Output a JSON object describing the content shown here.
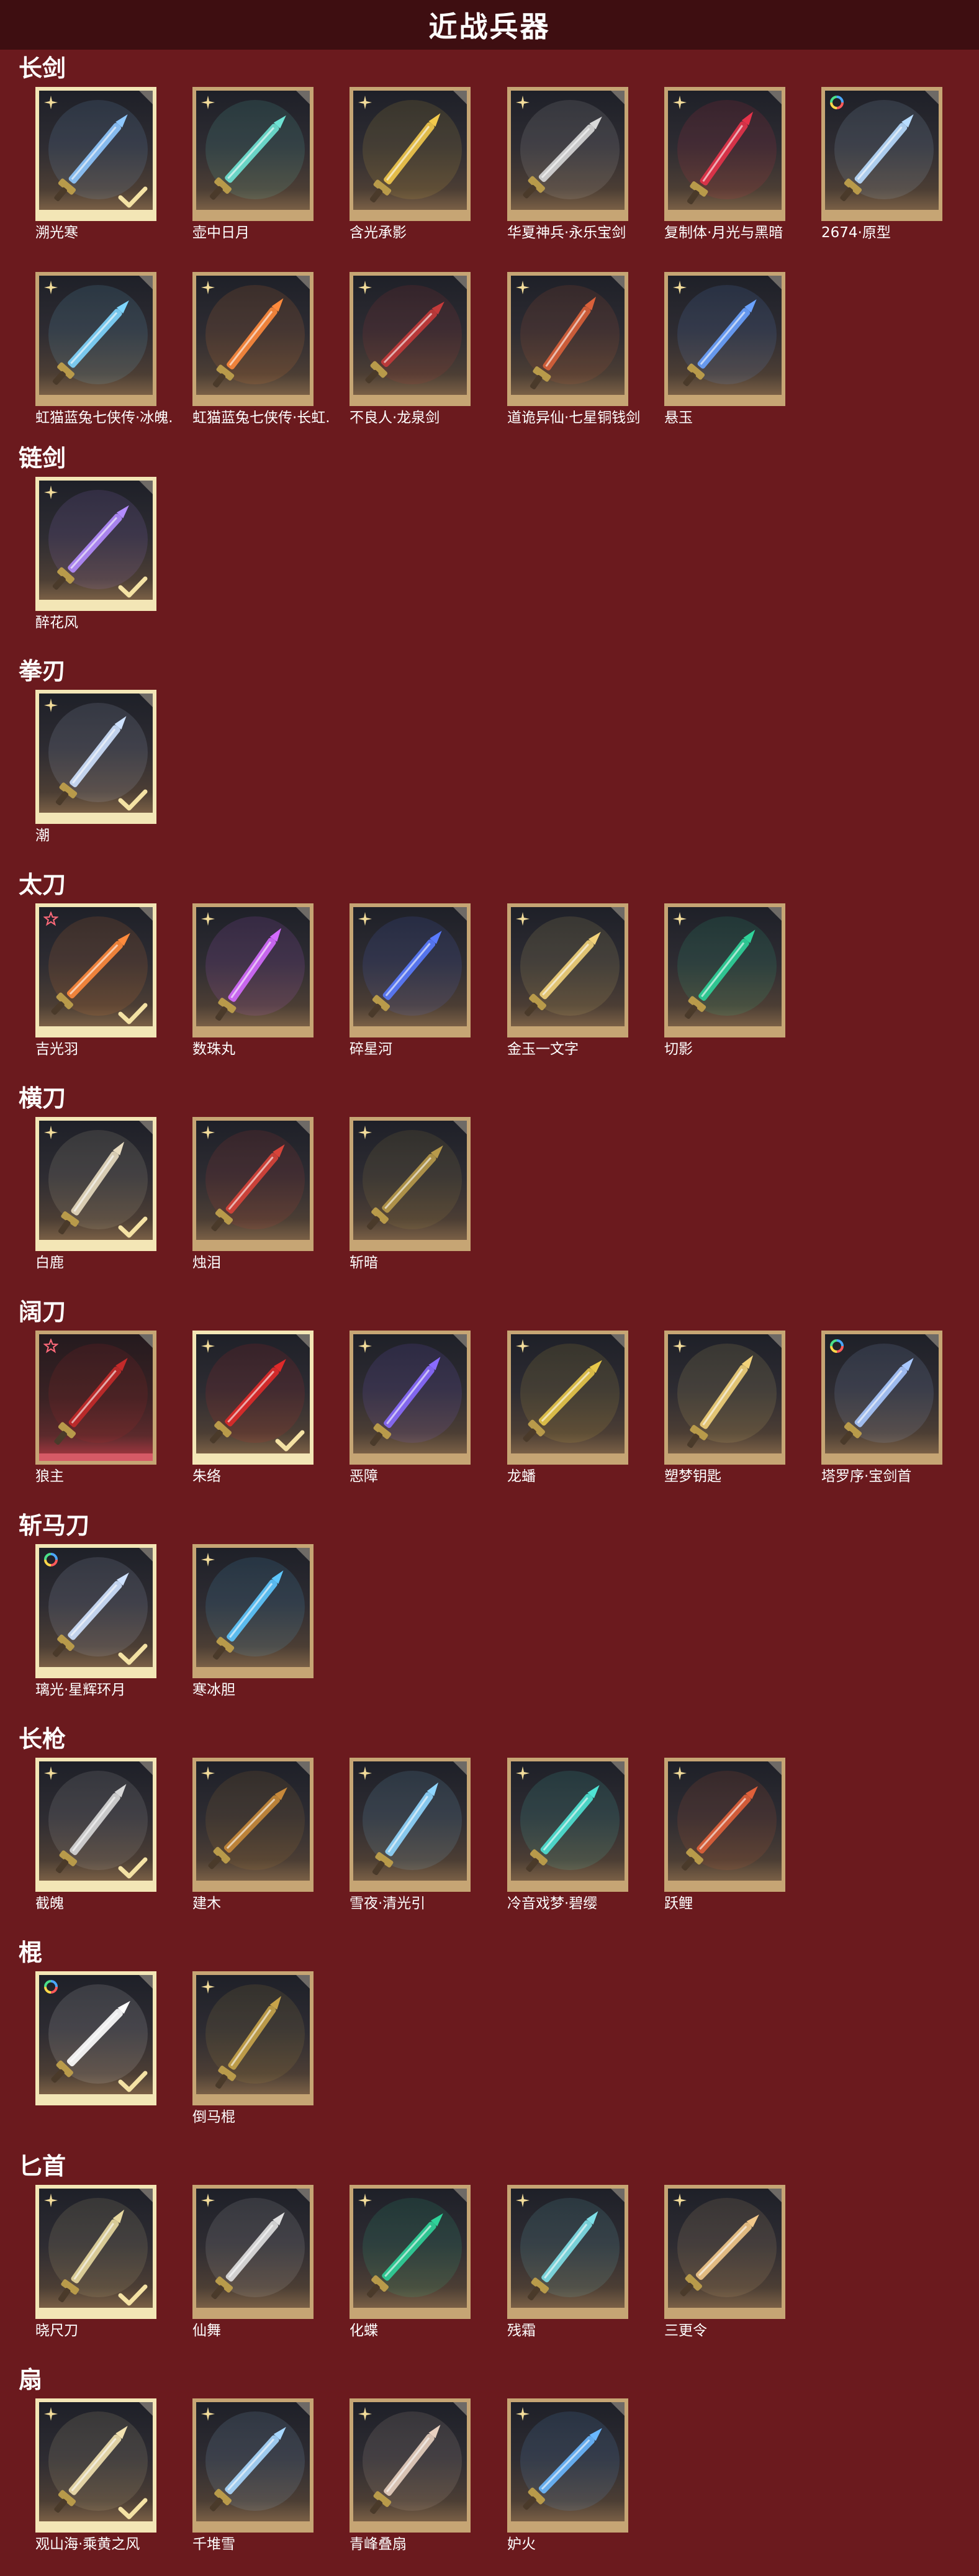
{
  "page": {
    "title": "近战兵器"
  },
  "colors": {
    "background": "#6b1a1e",
    "titlebar": "#3e0e11",
    "frame": "#c6a574",
    "frame_selected": "#f3e6b6"
  },
  "categories": [
    {
      "title": "长剑",
      "items": [
        {
          "name": "溯光寒",
          "rarity": "star-gold",
          "selected": true,
          "glow": "#8fc8ff",
          "hue": "ice"
        },
        {
          "name": "壶中日月",
          "rarity": "star-gold",
          "selected": false,
          "glow": "#6fe3d4",
          "hue": "teal"
        },
        {
          "name": "含光承影",
          "rarity": "star-gold",
          "selected": false,
          "glow": "#f2c94c",
          "hue": "gold"
        },
        {
          "name": "华夏神兵·永乐宝剑",
          "rarity": "star-gold",
          "selected": false,
          "glow": "#d8d8d8",
          "hue": "silver"
        },
        {
          "name": "复制体·月光与黑暗",
          "rarity": "star-gold",
          "selected": false,
          "glow": "#e5334a",
          "hue": "red"
        },
        {
          "name": "2674·原型",
          "rarity": "rainbow",
          "selected": false,
          "glow": "#b8dcff",
          "hue": "white"
        },
        {
          "name": "虹猫蓝兔七侠传·冰魄..",
          "rarity": "star-gold",
          "selected": false,
          "glow": "#7fd6ff",
          "hue": "ice"
        },
        {
          "name": "虹猫蓝兔七侠传·长虹..",
          "rarity": "star-gold",
          "selected": false,
          "glow": "#ff8a3c",
          "hue": "orange"
        },
        {
          "name": "不良人·龙泉剑",
          "rarity": "star-gold",
          "selected": false,
          "glow": "#c43a3a",
          "hue": "dark"
        },
        {
          "name": "道诡异仙·七星铜钱剑",
          "rarity": "star-gold",
          "selected": false,
          "glow": "#d9603a",
          "hue": "red"
        },
        {
          "name": "悬玉",
          "rarity": "star-gold",
          "selected": false,
          "glow": "#6aa2ff",
          "hue": "blue"
        }
      ]
    },
    {
      "title": "链剑",
      "items": [
        {
          "name": "醉花风",
          "rarity": "star-gold",
          "selected": true,
          "glow": "#b48cff",
          "hue": "purple"
        }
      ]
    },
    {
      "title": "拳刃",
      "items": [
        {
          "name": "潮",
          "rarity": "star-gold",
          "selected": true,
          "glow": "#cfe2ff",
          "hue": "white"
        }
      ]
    },
    {
      "title": "太刀",
      "items": [
        {
          "name": "吉光羽",
          "rarity": "star-red",
          "selected": true,
          "glow": "#ff8a3c",
          "hue": "orange"
        },
        {
          "name": "数珠丸",
          "rarity": "star-gold",
          "selected": false,
          "glow": "#d46bff",
          "hue": "purple"
        },
        {
          "name": "碎星河",
          "rarity": "star-gold",
          "selected": false,
          "glow": "#5a7bff",
          "hue": "blue"
        },
        {
          "name": "金玉一文字",
          "rarity": "star-gold",
          "selected": false,
          "glow": "#f2d27a",
          "hue": "gold"
        },
        {
          "name": "切影",
          "rarity": "star-gold",
          "selected": false,
          "glow": "#2fd39a",
          "hue": "teal"
        }
      ]
    },
    {
      "title": "横刀",
      "items": [
        {
          "name": "白鹿",
          "rarity": "star-gold",
          "selected": true,
          "glow": "#e8dcc0",
          "hue": "white"
        },
        {
          "name": "烛泪",
          "rarity": "star-gold",
          "selected": false,
          "glow": "#d8443a",
          "hue": "red"
        },
        {
          "name": "斩暗",
          "rarity": "star-gold",
          "selected": false,
          "glow": "#b89a4a",
          "hue": "gold"
        }
      ]
    },
    {
      "title": "阔刀",
      "items": [
        {
          "name": "狼主",
          "rarity": "star-red",
          "selected": false,
          "red": true,
          "glow": "#c42a2a",
          "hue": "red"
        },
        {
          "name": "朱络",
          "rarity": "star-gold",
          "selected": true,
          "glow": "#e02a2a",
          "hue": "red"
        },
        {
          "name": "恶障",
          "rarity": "star-gold",
          "selected": false,
          "glow": "#8a6bff",
          "hue": "purple"
        },
        {
          "name": "龙蟠",
          "rarity": "star-gold",
          "selected": false,
          "glow": "#e8c84a",
          "hue": "gold"
        },
        {
          "name": "塑梦钥匙",
          "rarity": "star-gold",
          "selected": false,
          "glow": "#f2d27a",
          "hue": "gold"
        },
        {
          "name": "塔罗序·宝剑首",
          "rarity": "rainbow",
          "selected": false,
          "glow": "#a8c8ff",
          "hue": "blue"
        }
      ]
    },
    {
      "title": "斩马刀",
      "items": [
        {
          "name": "璃光·星辉环月",
          "rarity": "rainbow",
          "selected": true,
          "glow": "#cfe2ff",
          "hue": "white"
        },
        {
          "name": "寒冰胆",
          "rarity": "star-gold",
          "selected": false,
          "glow": "#5ec8ff",
          "hue": "ice"
        }
      ]
    },
    {
      "title": "长枪",
      "items": [
        {
          "name": "截魄",
          "rarity": "star-gold",
          "selected": true,
          "glow": "#d8d8d8",
          "hue": "silver"
        },
        {
          "name": "建木",
          "rarity": "star-gold",
          "selected": false,
          "glow": "#c8893a",
          "hue": "orange"
        },
        {
          "name": "雪夜·清光引",
          "rarity": "star-gold",
          "selected": false,
          "glow": "#8fd6ff",
          "hue": "ice"
        },
        {
          "name": "冷音戏梦·碧缨",
          "rarity": "star-gold",
          "selected": false,
          "glow": "#4fe3d4",
          "hue": "teal"
        },
        {
          "name": "跃鲤",
          "rarity": "star-gold",
          "selected": false,
          "glow": "#e0603a",
          "hue": "orange"
        }
      ]
    },
    {
      "title": "棍",
      "items": [
        {
          "name": "",
          "rarity": "rainbow",
          "selected": true,
          "glow": "#ffffff",
          "hue": "white"
        },
        {
          "name": "倒马棍",
          "rarity": "star-gold",
          "selected": false,
          "glow": "#c8a44a",
          "hue": "gold"
        }
      ]
    },
    {
      "title": "匕首",
      "items": [
        {
          "name": "晓尺刀",
          "rarity": "star-gold",
          "selected": true,
          "glow": "#e8d9a0",
          "hue": "gold"
        },
        {
          "name": "仙舞",
          "rarity": "star-gold",
          "selected": false,
          "glow": "#e0e0e0",
          "hue": "silver"
        },
        {
          "name": "化蝶",
          "rarity": "star-gold",
          "selected": false,
          "glow": "#2fd39a",
          "hue": "teal"
        },
        {
          "name": "残霜",
          "rarity": "star-gold",
          "selected": false,
          "glow": "#7fe0e8",
          "hue": "ice"
        },
        {
          "name": "三更令",
          "rarity": "star-gold",
          "selected": false,
          "glow": "#f2c88a",
          "hue": "gold"
        }
      ]
    },
    {
      "title": "扇",
      "items": [
        {
          "name": "观山海·乘黄之风",
          "rarity": "star-gold",
          "selected": true,
          "glow": "#f2e2b0",
          "hue": "gold"
        },
        {
          "name": "千堆雪",
          "rarity": "star-gold",
          "selected": false,
          "glow": "#a8d8ff",
          "hue": "ice"
        },
        {
          "name": "青峰叠扇",
          "rarity": "star-gold",
          "selected": false,
          "glow": "#e8d0c0",
          "hue": "silver"
        },
        {
          "name": "妒火",
          "rarity": "star-gold",
          "selected": false,
          "glow": "#6ab8ff",
          "hue": "blue"
        }
      ]
    }
  ]
}
